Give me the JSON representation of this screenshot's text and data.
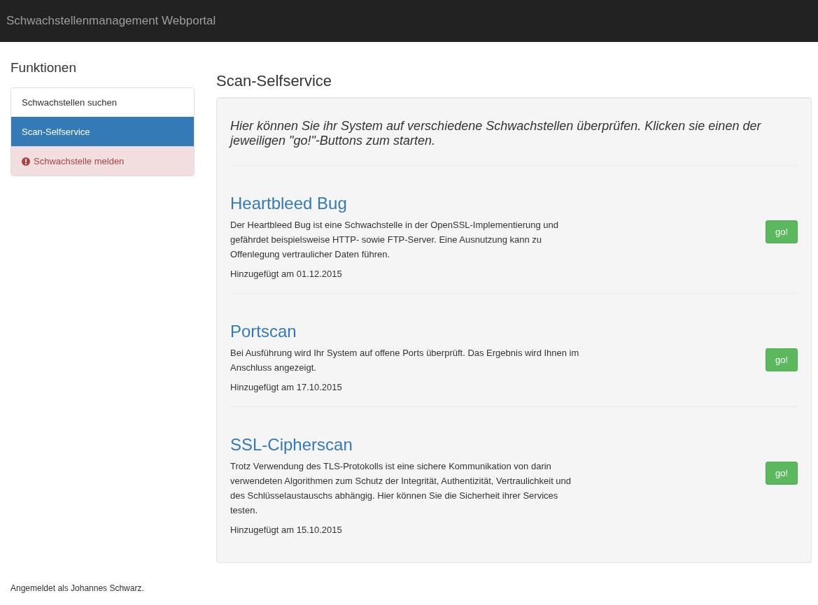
{
  "navbar": {
    "brand": "Schwachstellenmanagement Webportal"
  },
  "sidebar": {
    "title": "Funktionen",
    "items": [
      {
        "label": "Schwachstellen suchen",
        "kind": "normal",
        "selected": false
      },
      {
        "label": "Scan-Selfservice",
        "kind": "normal",
        "selected": true
      },
      {
        "label": "Schwachstelle melden",
        "kind": "danger",
        "selected": false
      }
    ]
  },
  "main": {
    "title": "Scan-Selfservice",
    "intro": "Hier können Sie ihr System auf verschiedene Schwachstellen überprüfen. Klicken sie einen der jeweiligen \"go!\"-Buttons zum starten.",
    "scans": [
      {
        "title": "Heartbleed Bug",
        "description": "Der Heartbleed Bug ist eine Schwachstelle in der OpenSSL-Implementierung und gefährdet beispielsweise HTTP- sowie FTP-Server. Eine Ausnutzung kann zu Offenlegung vertraulicher Daten führen.",
        "date": "Hinzugefügt am 01.12.2015",
        "button": "go!"
      },
      {
        "title": "Portscan",
        "description": "Bei Ausführung wird Ihr System auf offene Ports überprüft. Das Ergebnis wird Ihnen im Anschluss angezeigt.",
        "date": "Hinzugefügt am 17.10.2015",
        "button": "go!"
      },
      {
        "title": "SSL-Cipherscan",
        "description": "Trotz Verwendung des TLS-Protokolls ist eine sichere Kommunikation von darin verwendeten Algorithmen zum Schutz der Integrität, Authentizität, Vertraulichkeit und des Schlüsselaustauschs abhängig. Hier können Sie die Sicherheit ihrer Services testen.",
        "date": "Hinzugefügt am 15.10.2015",
        "button": "go!"
      }
    ]
  },
  "footer": {
    "text": "Angemeldet als Johannes Schwarz."
  }
}
